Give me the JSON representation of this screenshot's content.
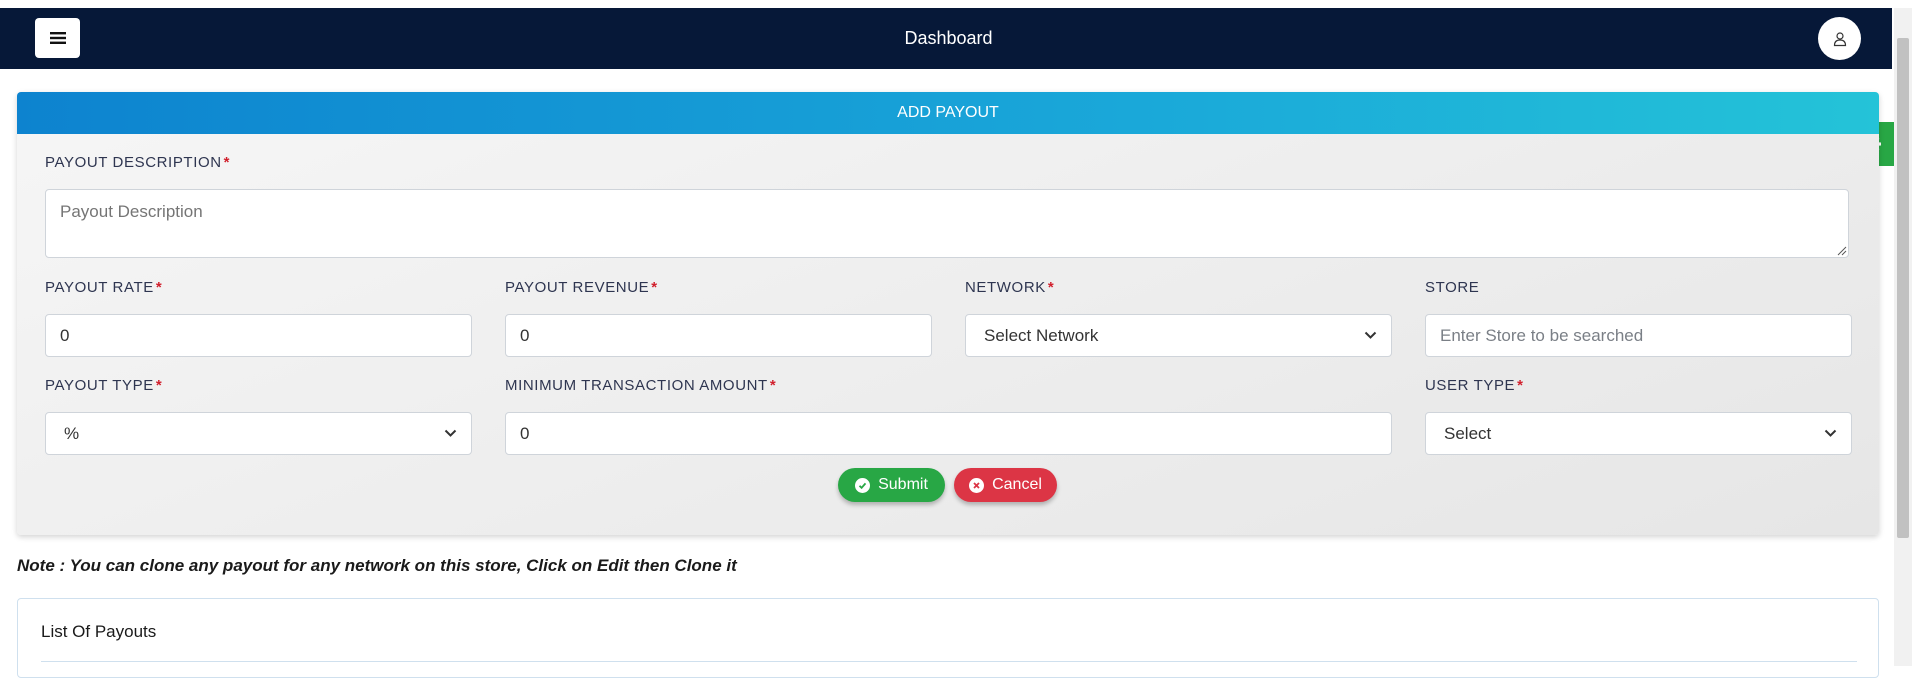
{
  "navbar": {
    "title": "Dashboard",
    "menu_icon": "bars-icon",
    "user_icon": "user-icon"
  },
  "settings_tab": {
    "icon": "gear-icon"
  },
  "form": {
    "header": "ADD PAYOUT",
    "required_mark": "*",
    "fields": {
      "description": {
        "label": "PAYOUT DESCRIPTION",
        "placeholder": "Payout Description",
        "value": ""
      },
      "rate": {
        "label": "PAYOUT RATE",
        "value": "0"
      },
      "revenue": {
        "label": "PAYOUT REVENUE",
        "value": "0"
      },
      "network": {
        "label": "NETWORK",
        "selected": "Select Network"
      },
      "store": {
        "label": "STORE",
        "placeholder": "Enter Store to be searched",
        "value": ""
      },
      "type": {
        "label": "PAYOUT TYPE",
        "selected": "%"
      },
      "min_amount": {
        "label": "MINIMUM TRANSACTION AMOUNT",
        "value": "0"
      },
      "user_type": {
        "label": "USER TYPE",
        "selected": "Select"
      }
    },
    "buttons": {
      "submit": "Submit",
      "cancel": "Cancel"
    }
  },
  "note": "Note : You can clone any payout for any network on this store, Click on Edit then Clone it",
  "list": {
    "title": "List Of Payouts"
  },
  "colors": {
    "navbar": "#061838",
    "header_start": "#0d83cf",
    "header_end": "#24c3d8",
    "submit": "#28a745",
    "cancel": "#dc3545",
    "required": "#d11f2c"
  }
}
